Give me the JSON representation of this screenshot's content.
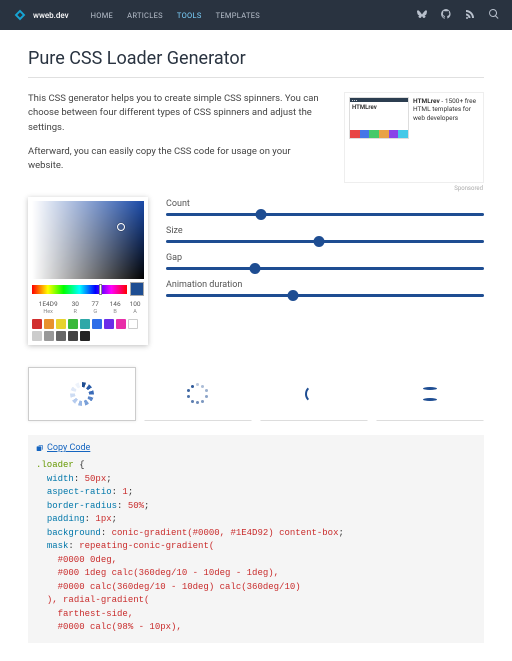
{
  "header": {
    "brand": "wweb.dev",
    "nav": [
      "HOME",
      "ARTICLES",
      "TOOLS",
      "TEMPLATES"
    ],
    "active_index": 2
  },
  "page": {
    "title": "Pure CSS Loader Generator",
    "desc1": "This CSS generator helps you to create simple CSS spinners. You can choose between four different types of CSS spinners and adjust the settings.",
    "desc2": "Afterward, you can easily copy the CSS code for usage on your website."
  },
  "ad": {
    "logo": "HTMLrev",
    "title": "HTMLrev",
    "subtitle": " - 1500+ free HTML templates for web developers",
    "sponsored": "Sponsored"
  },
  "picker": {
    "hex": "1E4D9",
    "r": "30",
    "g": "77",
    "b": "146",
    "a": "100",
    "labels": {
      "hex": "Hex",
      "r": "R",
      "g": "G",
      "b": "B",
      "a": "A"
    },
    "color": "#1E4D92",
    "preset_colors": [
      "#d12e2e",
      "#e8912e",
      "#e8d32e",
      "#3bb83b",
      "#2ea8a8",
      "#2e6de8",
      "#6b2ee8",
      "#e82ea8",
      "#ffffff",
      "#cccccc",
      "#999999",
      "#666666",
      "#444444",
      "#222222"
    ]
  },
  "sliders": [
    {
      "label": "Count",
      "pos": 30
    },
    {
      "label": "Size",
      "pos": 48
    },
    {
      "label": "Gap",
      "pos": 28
    },
    {
      "label": "Animation duration",
      "pos": 40
    }
  ],
  "copy": "Copy Code",
  "code": {
    "selector": ".loader",
    "lines": [
      {
        "prop": "width",
        "val": " 50px"
      },
      {
        "prop": "aspect-ratio",
        "val": " 1"
      },
      {
        "prop": "border-radius",
        "val": " 50%"
      },
      {
        "prop": "padding",
        "val": " 1px"
      },
      {
        "prop": "background",
        "val": " conic-gradient(#0000, #1E4D92) content-box"
      },
      {
        "prop": "mask",
        "val": " repeating-conic-gradient("
      }
    ],
    "mask_lines": [
      "#0000 0deg,",
      "#000 1deg calc(360deg/10 - 10deg - 1deg),",
      "#0000 calc(360deg/10 - 10deg) calc(360deg/10)"
    ],
    "radial": "), radial-gradient(",
    "radial_lines": [
      "farthest-side,",
      "#0000 calc(98% - 10px),"
    ]
  }
}
